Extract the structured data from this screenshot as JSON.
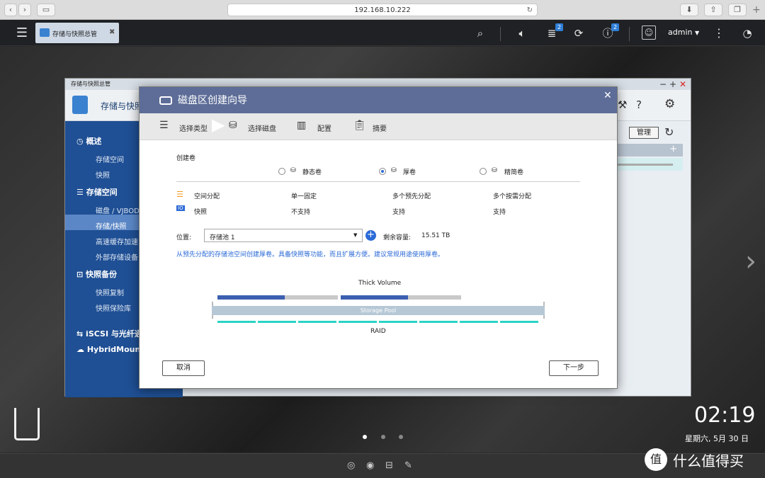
{
  "browser": {
    "url": "192.168.10.222"
  },
  "topbar": {
    "app_tab": "存储与快照总管",
    "notification_count": "2",
    "info_count": "2",
    "user": "admin"
  },
  "app": {
    "window_title": "存储与快照总管",
    "header_title": "存储与快照",
    "manage_button": "管理",
    "sidebar": {
      "overview": "概述",
      "storage_space_sub": "存储空间",
      "snapshot_sub": "快照",
      "storage_space": "存储空间",
      "disk_vjbod": "磁盘 / VJBOD",
      "storage_snapshot": "存储/快照",
      "cache_accel": "高速缓存加速",
      "external_device": "外部存储设备",
      "snapshot_backup": "快照备份",
      "snapshot_replica": "快照复制",
      "snapshot_vault": "快照保险库",
      "iscsi": "iSCSI 与光纤通",
      "hybridmount": "HybridMount"
    }
  },
  "wizard": {
    "title": "磁盘区创建向导",
    "steps": [
      "选择类型",
      "选择磁盘",
      "配置",
      "摘要"
    ],
    "section_label": "创建卷",
    "volume_types": [
      "静态卷",
      "厚卷",
      "精简卷"
    ],
    "selected_type": "厚卷",
    "rows": [
      {
        "name": "空间分配",
        "values": [
          "单一固定",
          "多个预先分配",
          "多个按需分配"
        ]
      },
      {
        "name": "快照",
        "values": [
          "不支持",
          "支持",
          "支持"
        ]
      }
    ],
    "location_label": "位置:",
    "location_value": "存储池 1",
    "free_label": "剩余容量:",
    "free_value": "15.51 TB",
    "description": "从预先分配的存储池空间创建厚卷。具备快照等功能，而且扩展方便。建议常规用途使用厚卷。",
    "diagram": {
      "thick_label": "Thick Volume",
      "pool_label": "Storage Pool",
      "raid_label": "RAID"
    },
    "cancel": "取消",
    "next": "下一步"
  },
  "desktop": {
    "time": "02:19",
    "date": "星期六, 5月 30 日",
    "watermark": "什么值得买"
  },
  "colors": {
    "accent": "#2b6ad6",
    "wizard_header": "#5d6d98",
    "sidebar": "#1f4f94",
    "raid": "#2bd3c5"
  }
}
